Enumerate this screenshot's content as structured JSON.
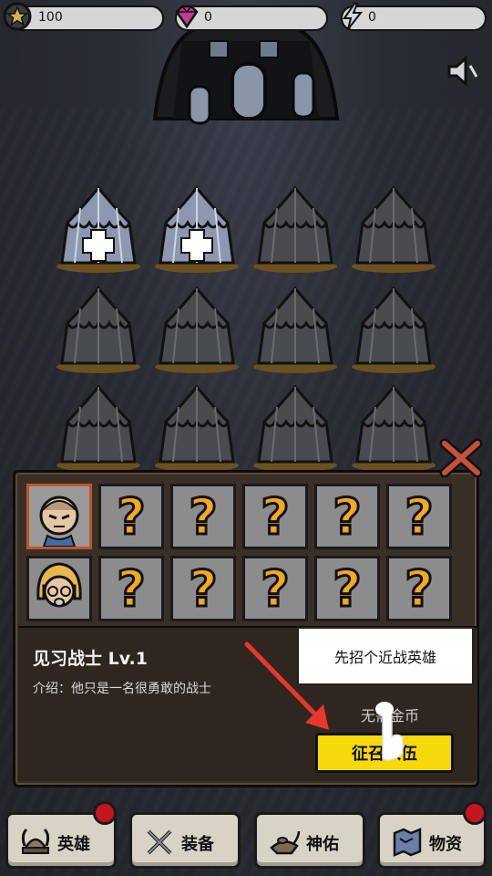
{
  "resources": {
    "coins": {
      "icon": "star-coin-icon",
      "value": "100"
    },
    "gems": {
      "icon": "gem-icon",
      "value": "0"
    },
    "energy": {
      "icon": "lightning-icon",
      "value": "0"
    }
  },
  "sound": {
    "icon": "speaker-icon"
  },
  "tents": {
    "rows": [
      [
        {
          "state": "unlocked-add"
        },
        {
          "state": "unlocked-add"
        },
        {
          "state": "locked"
        },
        {
          "state": "locked"
        }
      ],
      [
        {
          "state": "locked"
        },
        {
          "state": "locked"
        },
        {
          "state": "locked"
        },
        {
          "state": "locked"
        }
      ],
      [
        {
          "state": "locked"
        },
        {
          "state": "locked"
        },
        {
          "state": "locked"
        },
        {
          "state": "locked"
        }
      ]
    ]
  },
  "recruit_panel": {
    "close_icon": "close-x-icon",
    "slots_row1": [
      {
        "type": "hero",
        "name": "bald-warrior-portrait"
      },
      {
        "type": "unknown",
        "label": "?"
      },
      {
        "type": "unknown",
        "label": "?"
      },
      {
        "type": "unknown",
        "label": "?"
      },
      {
        "type": "unknown",
        "label": "?"
      },
      {
        "type": "unknown",
        "label": "?"
      }
    ],
    "slots_row2": [
      {
        "type": "hero",
        "name": "blonde-hero-portrait"
      },
      {
        "type": "unknown",
        "label": "?"
      },
      {
        "type": "unknown",
        "label": "?"
      },
      {
        "type": "unknown",
        "label": "?"
      },
      {
        "type": "unknown",
        "label": "?"
      },
      {
        "type": "unknown",
        "label": "?"
      }
    ],
    "hero_name": "见习战士 Lv.1",
    "hero_intro": "介绍：他只是一名很勇敢的战士",
    "cost_text": "无需金币",
    "recruit_button": "征召入伍"
  },
  "tutorial": {
    "tip": "先招个近战英雄",
    "arrow_color": "#e8372c"
  },
  "nav": [
    {
      "icon": "viking-helmet-icon",
      "label": "英雄",
      "badge": true
    },
    {
      "icon": "crossed-swords-icon",
      "label": "装备",
      "badge": false
    },
    {
      "icon": "magic-lamp-icon",
      "label": "神佑",
      "badge": false
    },
    {
      "icon": "treasure-map-icon",
      "label": "物资",
      "badge": true
    }
  ],
  "colors": {
    "accent_yellow": "#f5d90a",
    "question_orange": "#f2a91f",
    "badge_red": "#c4161c",
    "selected_border": "#c0552a"
  }
}
